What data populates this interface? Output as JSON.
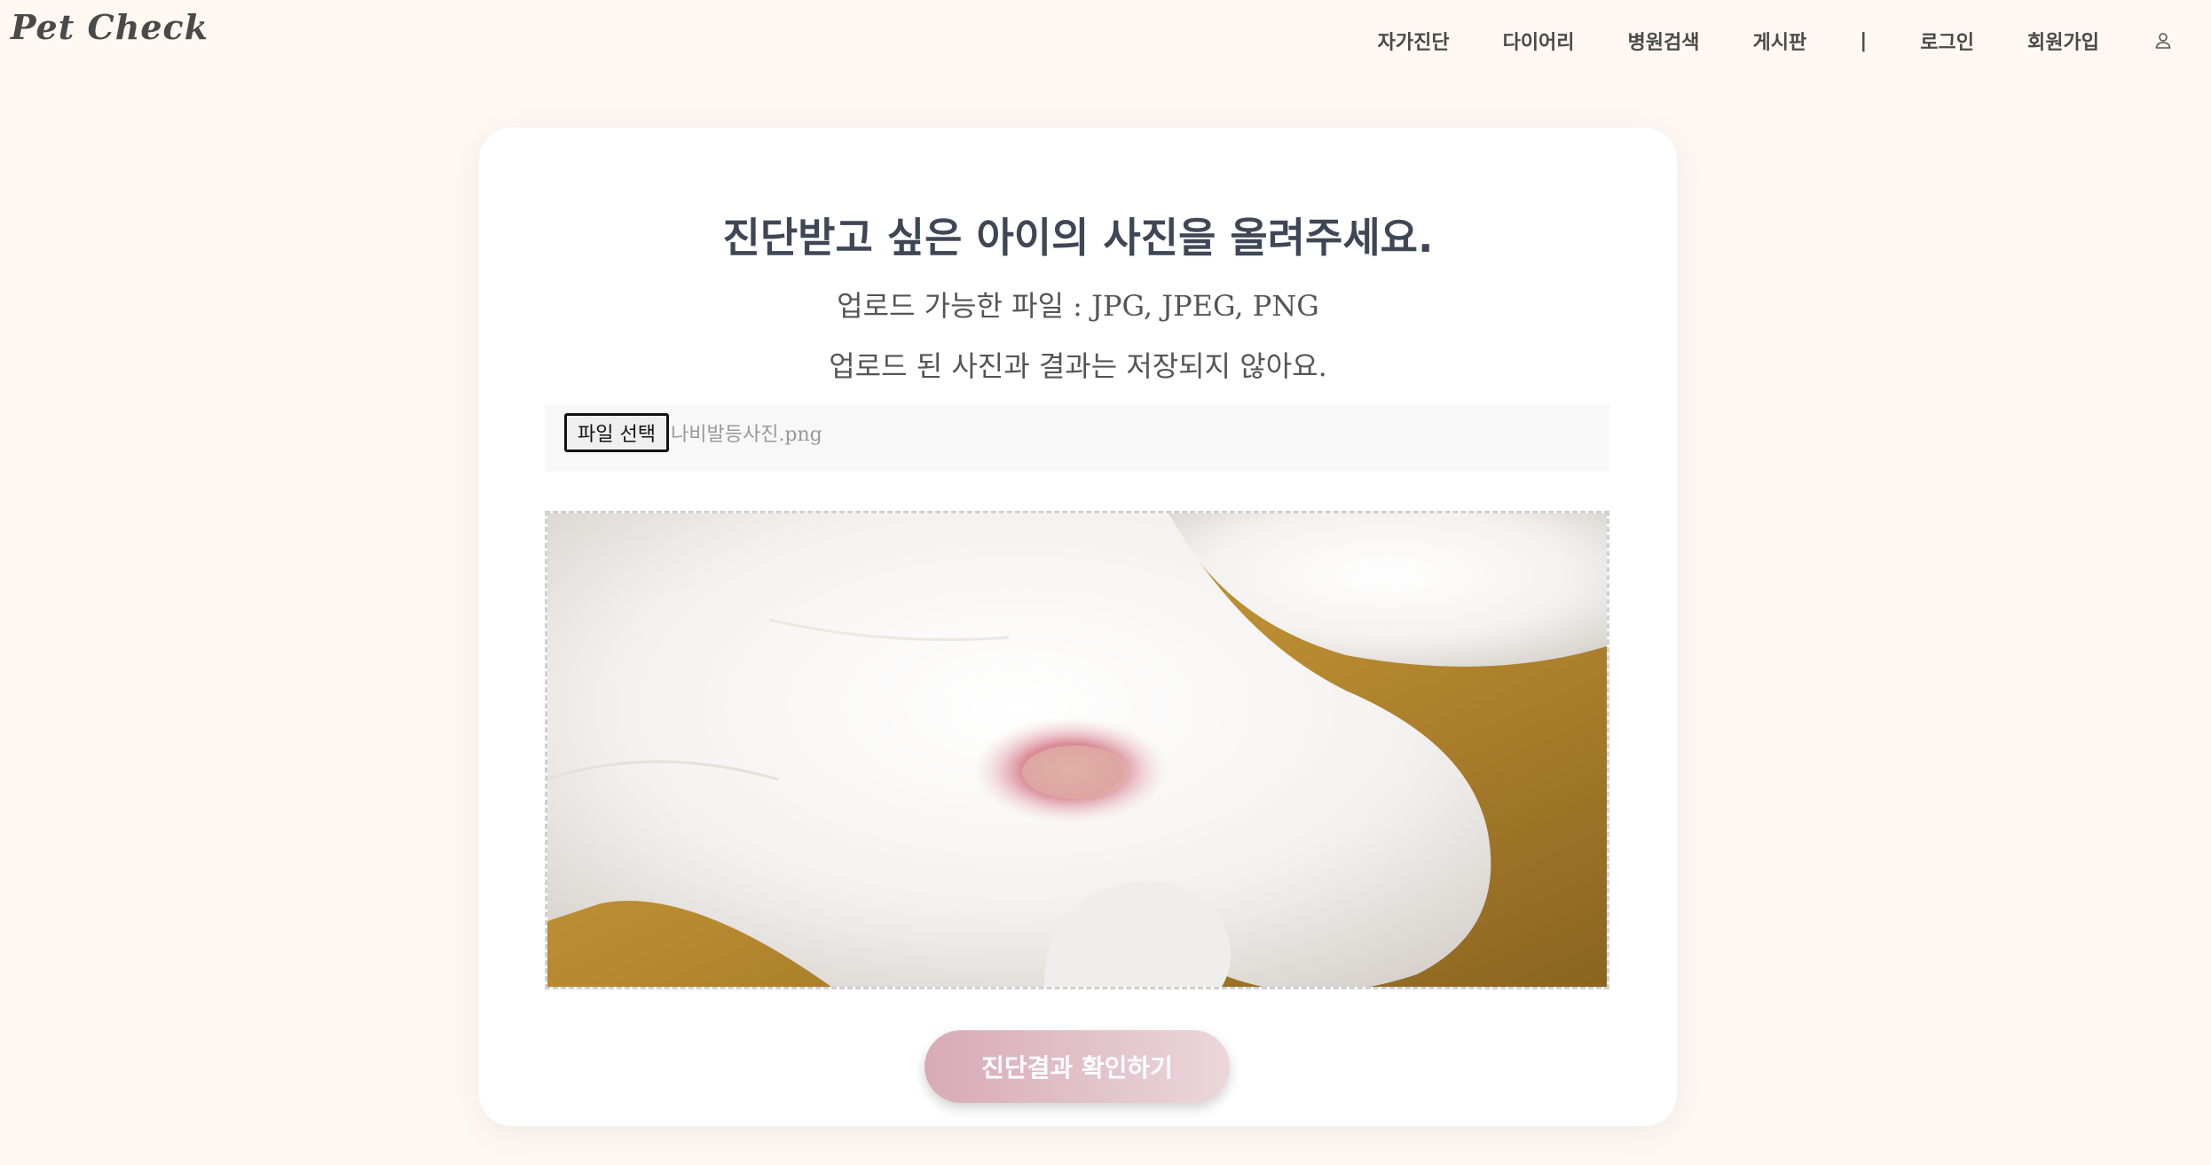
{
  "app": {
    "logo": "Pet Check"
  },
  "nav": {
    "items": [
      "자가진단",
      "다이어리",
      "병원검색",
      "게시판"
    ],
    "separator": "|",
    "login": "로그인",
    "signup": "회원가입",
    "user_icon": "user-icon"
  },
  "upload": {
    "title": "진단받고 싶은 아이의 사진을 올려주세요.",
    "formats": "업로드 가능한 파일 : JPG, JPEG, PNG",
    "notice": "업로드 된 사진과 결과는 저장되지 않아요.",
    "file_button": "파일 선택",
    "file_name": "나비발등사진.png"
  },
  "actions": {
    "diagnose": "진단결과 확인하기"
  },
  "colors": {
    "background": "#fff8f2",
    "card": "#ffffff",
    "button_start": "#d7aab7",
    "button_end": "#ebd7da"
  }
}
